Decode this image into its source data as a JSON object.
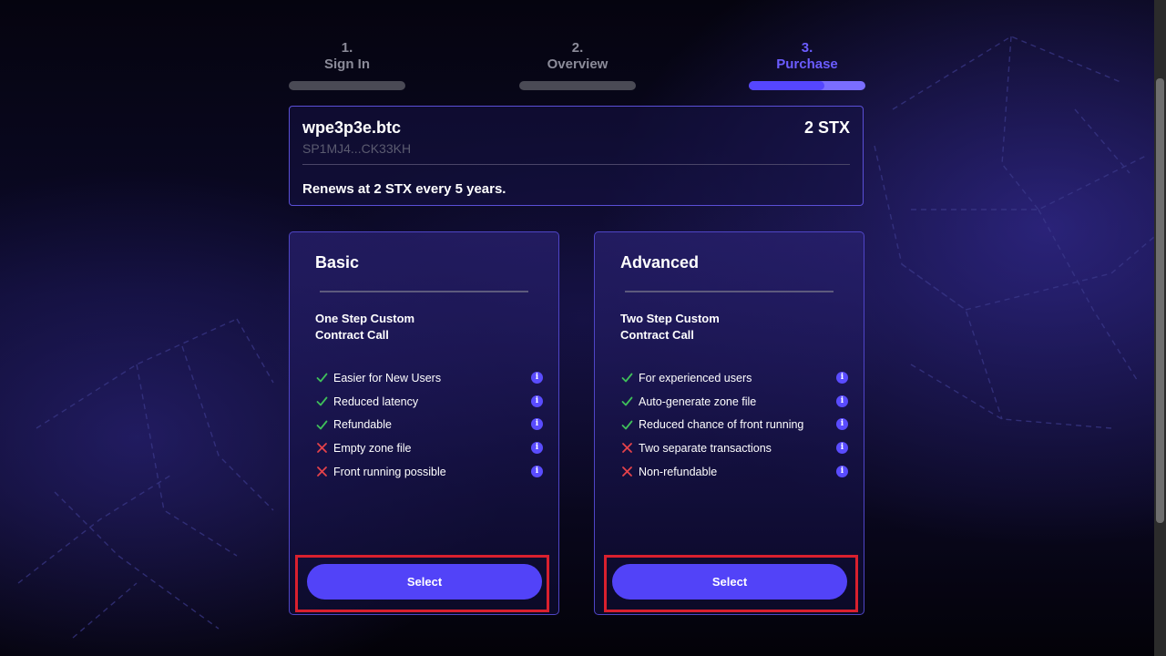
{
  "stepper": {
    "steps": [
      {
        "number": "1.",
        "label": "Sign In",
        "active": false
      },
      {
        "number": "2.",
        "label": "Overview",
        "active": false
      },
      {
        "number": "3.",
        "label": "Purchase",
        "active": true
      }
    ],
    "active_progress": 0.65
  },
  "summary": {
    "name": "wpe3p3e.btc",
    "address": "SP1MJ4...CK33KH",
    "price": "2 STX",
    "renewal": "Renews at 2 STX every 5 years."
  },
  "plans": [
    {
      "title": "Basic",
      "subtitle": "One Step Custom Contract Call",
      "features": [
        {
          "text": "Easier for New Users",
          "positive": true
        },
        {
          "text": "Reduced latency",
          "positive": true
        },
        {
          "text": "Refundable",
          "positive": true
        },
        {
          "text": "Empty zone file",
          "positive": false
        },
        {
          "text": "Front running possible",
          "positive": false
        }
      ],
      "button": "Select"
    },
    {
      "title": "Advanced",
      "subtitle": "Two Step Custom Contract Call",
      "features": [
        {
          "text": "For experienced users",
          "positive": true
        },
        {
          "text": "Auto-generate zone file",
          "positive": true
        },
        {
          "text": "Reduced chance of front running",
          "positive": true
        },
        {
          "text": "Two separate transactions",
          "positive": false
        },
        {
          "text": "Non-refundable",
          "positive": false
        }
      ],
      "button": "Select"
    }
  ],
  "colors": {
    "accent": "#5243f8",
    "check": "#3fbf5a",
    "cross": "#e5424a",
    "highlight": "#d9202e"
  },
  "icons": {
    "check": "check-icon",
    "cross": "close-icon",
    "info": "info-icon"
  }
}
